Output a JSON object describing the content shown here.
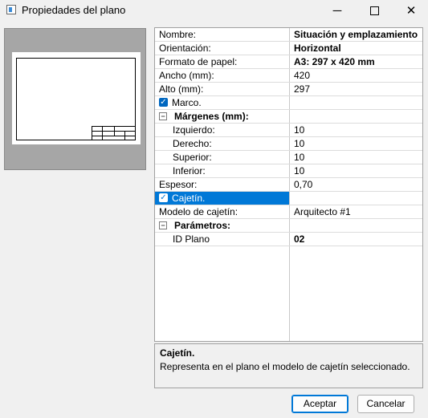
{
  "window": {
    "title": "Propiedades del plano"
  },
  "properties": {
    "nombre": {
      "label": "Nombre:",
      "value": "Situación y emplazamiento"
    },
    "orientacion": {
      "label": "Orientación:",
      "value": "Horizontal"
    },
    "formato": {
      "label": "Formato de papel:",
      "value": "A3: 297 x 420 mm"
    },
    "ancho": {
      "label": "Ancho (mm):",
      "value": "420"
    },
    "alto": {
      "label": "Alto (mm):",
      "value": "297"
    },
    "marco": {
      "label": "Marco.",
      "checked": true
    },
    "margenes": {
      "label": "Márgenes (mm):",
      "izquierdo": {
        "label": "Izquierdo:",
        "value": "10"
      },
      "derecho": {
        "label": "Derecho:",
        "value": "10"
      },
      "superior": {
        "label": "Superior:",
        "value": "10"
      },
      "inferior": {
        "label": "Inferior:",
        "value": "10"
      }
    },
    "espesor": {
      "label": "Espesor:",
      "value": "0,70"
    },
    "cajetin": {
      "label": "Cajetín.",
      "checked": true
    },
    "modelo": {
      "label": "Modelo de cajetín:",
      "value": "Arquitecto #1"
    },
    "parametros": {
      "label": "Parámetros:",
      "id_plano": {
        "label": "ID Plano",
        "value": "02"
      }
    }
  },
  "description": {
    "title": "Cajetín.",
    "text": "Representa en el plano el modelo de cajetín seleccionado."
  },
  "buttons": {
    "ok": "Aceptar",
    "cancel": "Cancelar"
  }
}
